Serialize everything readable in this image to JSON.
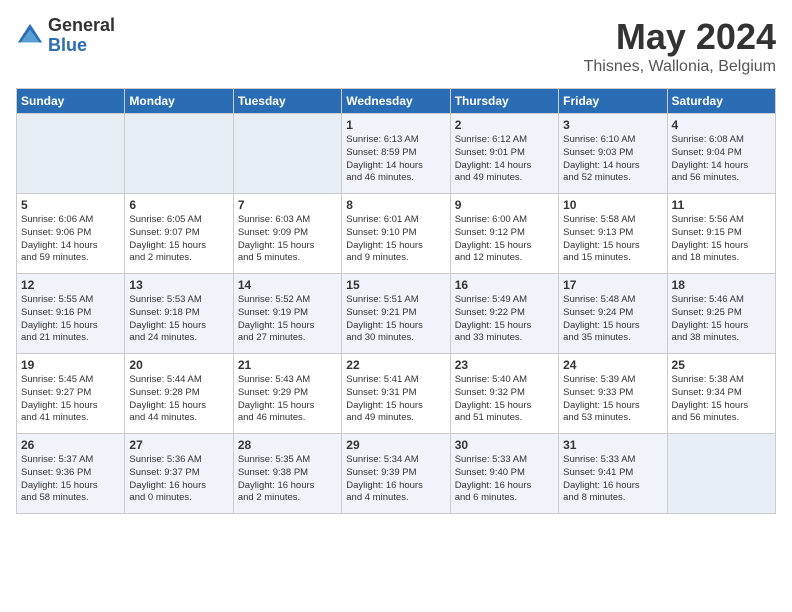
{
  "header": {
    "logo_general": "General",
    "logo_blue": "Blue",
    "month": "May 2024",
    "location": "Thisnes, Wallonia, Belgium"
  },
  "days_of_week": [
    "Sunday",
    "Monday",
    "Tuesday",
    "Wednesday",
    "Thursday",
    "Friday",
    "Saturday"
  ],
  "weeks": [
    [
      {
        "day": "",
        "info": ""
      },
      {
        "day": "",
        "info": ""
      },
      {
        "day": "",
        "info": ""
      },
      {
        "day": "1",
        "info": "Sunrise: 6:13 AM\nSunset: 8:59 PM\nDaylight: 14 hours\nand 46 minutes."
      },
      {
        "day": "2",
        "info": "Sunrise: 6:12 AM\nSunset: 9:01 PM\nDaylight: 14 hours\nand 49 minutes."
      },
      {
        "day": "3",
        "info": "Sunrise: 6:10 AM\nSunset: 9:03 PM\nDaylight: 14 hours\nand 52 minutes."
      },
      {
        "day": "4",
        "info": "Sunrise: 6:08 AM\nSunset: 9:04 PM\nDaylight: 14 hours\nand 56 minutes."
      }
    ],
    [
      {
        "day": "5",
        "info": "Sunrise: 6:06 AM\nSunset: 9:06 PM\nDaylight: 14 hours\nand 59 minutes."
      },
      {
        "day": "6",
        "info": "Sunrise: 6:05 AM\nSunset: 9:07 PM\nDaylight: 15 hours\nand 2 minutes."
      },
      {
        "day": "7",
        "info": "Sunrise: 6:03 AM\nSunset: 9:09 PM\nDaylight: 15 hours\nand 5 minutes."
      },
      {
        "day": "8",
        "info": "Sunrise: 6:01 AM\nSunset: 9:10 PM\nDaylight: 15 hours\nand 9 minutes."
      },
      {
        "day": "9",
        "info": "Sunrise: 6:00 AM\nSunset: 9:12 PM\nDaylight: 15 hours\nand 12 minutes."
      },
      {
        "day": "10",
        "info": "Sunrise: 5:58 AM\nSunset: 9:13 PM\nDaylight: 15 hours\nand 15 minutes."
      },
      {
        "day": "11",
        "info": "Sunrise: 5:56 AM\nSunset: 9:15 PM\nDaylight: 15 hours\nand 18 minutes."
      }
    ],
    [
      {
        "day": "12",
        "info": "Sunrise: 5:55 AM\nSunset: 9:16 PM\nDaylight: 15 hours\nand 21 minutes."
      },
      {
        "day": "13",
        "info": "Sunrise: 5:53 AM\nSunset: 9:18 PM\nDaylight: 15 hours\nand 24 minutes."
      },
      {
        "day": "14",
        "info": "Sunrise: 5:52 AM\nSunset: 9:19 PM\nDaylight: 15 hours\nand 27 minutes."
      },
      {
        "day": "15",
        "info": "Sunrise: 5:51 AM\nSunset: 9:21 PM\nDaylight: 15 hours\nand 30 minutes."
      },
      {
        "day": "16",
        "info": "Sunrise: 5:49 AM\nSunset: 9:22 PM\nDaylight: 15 hours\nand 33 minutes."
      },
      {
        "day": "17",
        "info": "Sunrise: 5:48 AM\nSunset: 9:24 PM\nDaylight: 15 hours\nand 35 minutes."
      },
      {
        "day": "18",
        "info": "Sunrise: 5:46 AM\nSunset: 9:25 PM\nDaylight: 15 hours\nand 38 minutes."
      }
    ],
    [
      {
        "day": "19",
        "info": "Sunrise: 5:45 AM\nSunset: 9:27 PM\nDaylight: 15 hours\nand 41 minutes."
      },
      {
        "day": "20",
        "info": "Sunrise: 5:44 AM\nSunset: 9:28 PM\nDaylight: 15 hours\nand 44 minutes."
      },
      {
        "day": "21",
        "info": "Sunrise: 5:43 AM\nSunset: 9:29 PM\nDaylight: 15 hours\nand 46 minutes."
      },
      {
        "day": "22",
        "info": "Sunrise: 5:41 AM\nSunset: 9:31 PM\nDaylight: 15 hours\nand 49 minutes."
      },
      {
        "day": "23",
        "info": "Sunrise: 5:40 AM\nSunset: 9:32 PM\nDaylight: 15 hours\nand 51 minutes."
      },
      {
        "day": "24",
        "info": "Sunrise: 5:39 AM\nSunset: 9:33 PM\nDaylight: 15 hours\nand 53 minutes."
      },
      {
        "day": "25",
        "info": "Sunrise: 5:38 AM\nSunset: 9:34 PM\nDaylight: 15 hours\nand 56 minutes."
      }
    ],
    [
      {
        "day": "26",
        "info": "Sunrise: 5:37 AM\nSunset: 9:36 PM\nDaylight: 15 hours\nand 58 minutes."
      },
      {
        "day": "27",
        "info": "Sunrise: 5:36 AM\nSunset: 9:37 PM\nDaylight: 16 hours\nand 0 minutes."
      },
      {
        "day": "28",
        "info": "Sunrise: 5:35 AM\nSunset: 9:38 PM\nDaylight: 16 hours\nand 2 minutes."
      },
      {
        "day": "29",
        "info": "Sunrise: 5:34 AM\nSunset: 9:39 PM\nDaylight: 16 hours\nand 4 minutes."
      },
      {
        "day": "30",
        "info": "Sunrise: 5:33 AM\nSunset: 9:40 PM\nDaylight: 16 hours\nand 6 minutes."
      },
      {
        "day": "31",
        "info": "Sunrise: 5:33 AM\nSunset: 9:41 PM\nDaylight: 16 hours\nand 8 minutes."
      },
      {
        "day": "",
        "info": ""
      }
    ]
  ]
}
